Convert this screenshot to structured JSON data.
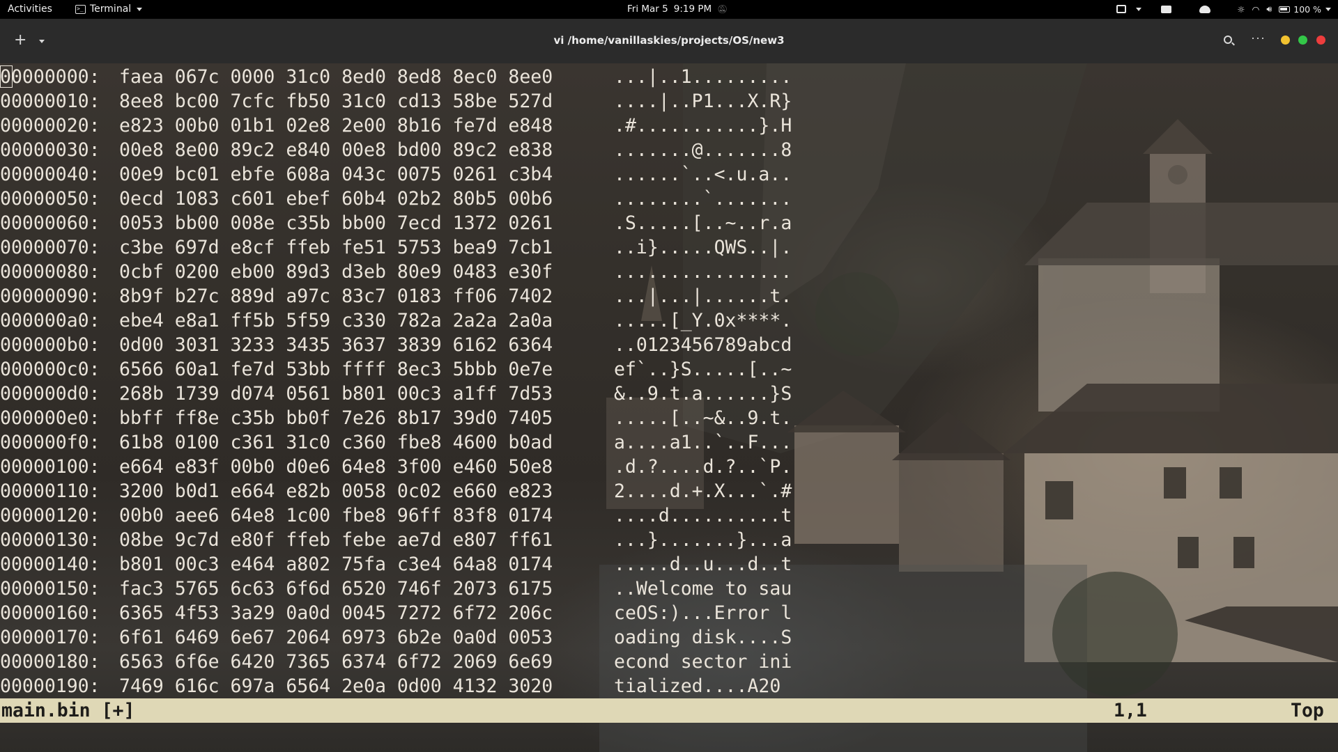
{
  "topbar": {
    "activities": "Activities",
    "app_name": "Terminal",
    "date": "Fri Mar 5",
    "time": "9:19 PM",
    "battery": "100 %",
    "indicators": [
      "display-icon",
      "screen-share-icon",
      "cloud-icon",
      "brightness-icon",
      "wifi-icon",
      "volume-icon",
      "battery-icon"
    ]
  },
  "header": {
    "new_tab": "+",
    "title": "vi /home/vanillaskies/projects/OS/new3",
    "more": "···",
    "buttons": {
      "minimize": "#f2c230",
      "maximize": "#33c748",
      "close": "#ed3d3d"
    }
  },
  "hexdump": [
    {
      "addr": "00000000:",
      "bytes": "faea 067c 0000 31c0 8ed0 8ed8 8ec0 8ee0",
      "ascii": "...|..1........."
    },
    {
      "addr": "00000010:",
      "bytes": "8ee8 bc00 7cfc fb50 31c0 cd13 58be 527d",
      "ascii": "....|..P1...X.R}"
    },
    {
      "addr": "00000020:",
      "bytes": "e823 00b0 01b1 02e8 2e00 8b16 fe7d e848",
      "ascii": ".#...........}.H"
    },
    {
      "addr": "00000030:",
      "bytes": "00e8 8e00 89c2 e840 00e8 bd00 89c2 e838",
      "ascii": ".......@.......8"
    },
    {
      "addr": "00000040:",
      "bytes": "00e9 bc01 ebfe 608a 043c 0075 0261 c3b4",
      "ascii": "......`..<.u.a.."
    },
    {
      "addr": "00000050:",
      "bytes": "0ecd 1083 c601 ebef 60b4 02b2 80b5 00b6",
      "ascii": "........`......."
    },
    {
      "addr": "00000060:",
      "bytes": "0053 bb00 008e c35b bb00 7ecd 1372 0261",
      "ascii": ".S.....[..~..r.a"
    },
    {
      "addr": "00000070:",
      "bytes": "c3be 697d e8cf ffeb fe51 5753 bea9 7cb1",
      "ascii": "..i}.....QWS..|."
    },
    {
      "addr": "00000080:",
      "bytes": "0cbf 0200 eb00 89d3 d3eb 80e9 0483 e30f",
      "ascii": "................"
    },
    {
      "addr": "00000090:",
      "bytes": "8b9f b27c 889d a97c 83c7 0183 ff06 7402",
      "ascii": "...|...|......t."
    },
    {
      "addr": "000000a0:",
      "bytes": "ebe4 e8a1 ff5b 5f59 c330 782a 2a2a 2a0a",
      "ascii": ".....[_Y.0x****."
    },
    {
      "addr": "000000b0:",
      "bytes": "0d00 3031 3233 3435 3637 3839 6162 6364",
      "ascii": "..0123456789abcd"
    },
    {
      "addr": "000000c0:",
      "bytes": "6566 60a1 fe7d 53bb ffff 8ec3 5bbb 0e7e",
      "ascii": "ef`..}S.....[..~"
    },
    {
      "addr": "000000d0:",
      "bytes": "268b 1739 d074 0561 b801 00c3 a1ff 7d53",
      "ascii": "&..9.t.a......}S"
    },
    {
      "addr": "000000e0:",
      "bytes": "bbff ff8e c35b bb0f 7e26 8b17 39d0 7405",
      "ascii": ".....[..~&..9.t."
    },
    {
      "addr": "000000f0:",
      "bytes": "61b8 0100 c361 31c0 c360 fbe8 4600 b0ad",
      "ascii": "a....a1..`..F..."
    },
    {
      "addr": "00000100:",
      "bytes": "e664 e83f 00b0 d0e6 64e8 3f00 e460 50e8",
      "ascii": ".d.?....d.?..`P."
    },
    {
      "addr": "00000110:",
      "bytes": "3200 b0d1 e664 e82b 0058 0c02 e660 e823",
      "ascii": "2....d.+.X...`.#"
    },
    {
      "addr": "00000120:",
      "bytes": "00b0 aee6 64e8 1c00 fbe8 96ff 83f8 0174",
      "ascii": "....d..........t"
    },
    {
      "addr": "00000130:",
      "bytes": "08be 9c7d e80f ffeb febe ae7d e807 ff61",
      "ascii": "...}.......}...a"
    },
    {
      "addr": "00000140:",
      "bytes": "b801 00c3 e464 a802 75fa c3e4 64a8 0174",
      "ascii": ".....d..u...d..t"
    },
    {
      "addr": "00000150:",
      "bytes": "fac3 5765 6c63 6f6d 6520 746f 2073 6175",
      "ascii": "..Welcome to sau"
    },
    {
      "addr": "00000160:",
      "bytes": "6365 4f53 3a29 0a0d 0045 7272 6f72 206c",
      "ascii": "ceOS:)...Error l"
    },
    {
      "addr": "00000170:",
      "bytes": "6f61 6469 6e67 2064 6973 6b2e 0a0d 0053",
      "ascii": "oading disk....S"
    },
    {
      "addr": "00000180:",
      "bytes": "6563 6f6e 6420 7365 6374 6f72 2069 6e69",
      "ascii": "econd sector ini"
    },
    {
      "addr": "00000190:",
      "bytes": "7469 616c 697a 6564 2e0a 0d00 4132 3020",
      "ascii": "tialized....A20 "
    }
  ],
  "statusline": {
    "file": "main.bin [+]",
    "position": "1,1",
    "scroll": "Top"
  }
}
